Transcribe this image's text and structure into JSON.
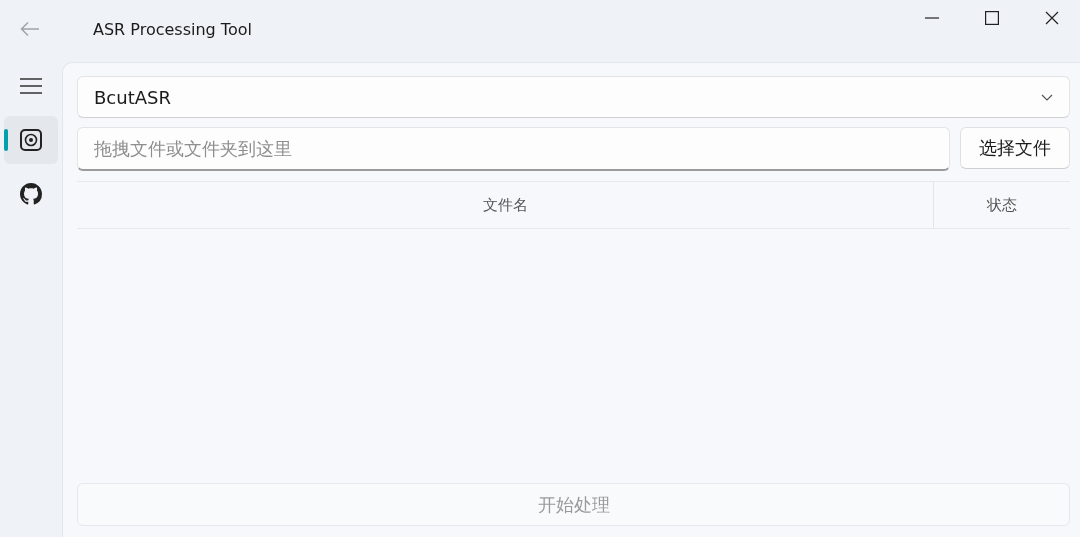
{
  "window": {
    "title": "ASR Processing Tool"
  },
  "nav_items": [
    {
      "kind": "menu",
      "selected": false
    },
    {
      "kind": "scan",
      "selected": true
    },
    {
      "kind": "github",
      "selected": false
    }
  ],
  "engine_select": {
    "value": "BcutASR"
  },
  "file_input": {
    "placeholder": "拖拽文件或文件夹到这里"
  },
  "choose_button": "选择文件",
  "table": {
    "columns": [
      "文件名",
      "状态"
    ]
  },
  "start_button": {
    "label": "开始处理",
    "disabled": true
  }
}
